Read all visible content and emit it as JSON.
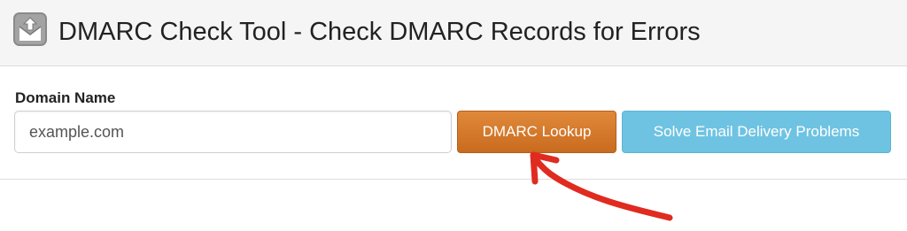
{
  "header": {
    "title": "DMARC Check Tool - Check DMARC Records for Errors",
    "icon": "mail-upload-icon"
  },
  "form": {
    "label": "Domain Name",
    "input_value": "example.com",
    "lookup_button": "DMARC Lookup",
    "solve_button": "Solve Email Delivery Problems"
  },
  "annotation": {
    "icon": "red-arrow-icon",
    "color": "#e02b20"
  },
  "colors": {
    "lookup_button": "#d47a2b",
    "solve_button": "#6ec3e2"
  }
}
